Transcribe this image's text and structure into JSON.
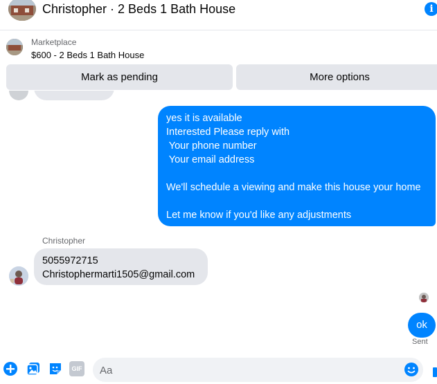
{
  "header": {
    "title": "Christopher · 2 Beds 1 Bath House",
    "info_icon": "i"
  },
  "marketplace": {
    "label": "Marketplace",
    "listing": "$600 - 2 Beds 1 Bath House"
  },
  "actions": {
    "pending_label": "Mark as pending",
    "more_label": "More options"
  },
  "messages": {
    "outgoing_text": "yes it is available\nInterested Please reply with\n Your phone number\n Your email address\n\nWe'll schedule a viewing and make this house your home\n\nLet me know if you'd like any adjustments",
    "sender_name": "Christopher",
    "incoming_line1": "5055972715",
    "incoming_line2": "Christophermarti1505@gmail.com",
    "reply": "ok",
    "status": "Sent"
  },
  "composer": {
    "placeholder": "Aa",
    "gif_label": "GIF"
  },
  "colors": {
    "accent": "#0084ff",
    "bubble_gray": "#e4e6eb",
    "input_bg": "#f0f2f5"
  }
}
